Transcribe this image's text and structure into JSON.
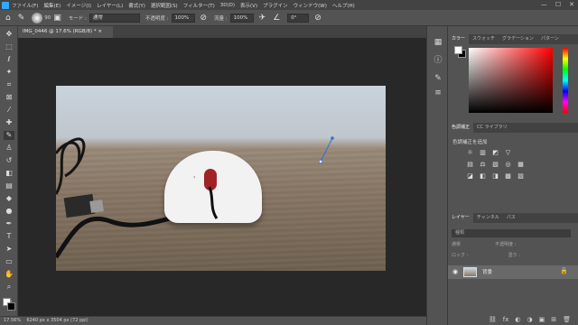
{
  "menubar": {
    "items": [
      "ファイル(F)",
      "編集(E)",
      "イメージ(I)",
      "レイヤー(L)",
      "書式(Y)",
      "選択範囲(S)",
      "フィルター(T)",
      "3D(D)",
      "表示(V)",
      "プラグイン",
      "ウィンドウ(W)",
      "ヘルプ(H)"
    ],
    "window_controls": [
      "—",
      "☐",
      "✕"
    ]
  },
  "options": {
    "brush_size": "90",
    "mode_label": "モード :",
    "mode_value": "通常",
    "opacity_label": "不透明度 :",
    "opacity_value": "100%",
    "flow_label": "流量 :",
    "flow_value": "100%",
    "angle_value": "0°"
  },
  "document": {
    "tab_title": "IMG_0446 @ 17.6% (RGB/8) *",
    "tab_close": "×"
  },
  "status": {
    "zoom": "17.56%",
    "dimensions": "6240 px x 3504 px (72 ppi)"
  },
  "panels": {
    "color_tabs": [
      "カラー",
      "スウォッチ",
      "グラデーション",
      "パターン"
    ],
    "adjust_tabs": [
      "色調補正",
      "CC ライブラリ"
    ],
    "adjust_title": "色調補正を追加",
    "adjust_icons": [
      [
        "☼",
        "▥",
        "◩",
        "▽"
      ],
      [
        "▤",
        "⚖",
        "▧",
        "◎",
        "▦"
      ],
      [
        "◪",
        "◧",
        "◨",
        "▩",
        "▨"
      ]
    ],
    "layer_tabs": [
      "レイヤー",
      "チャンネル",
      "パス"
    ],
    "layers_filter": "種類",
    "blend_mode": "通常",
    "layer_opacity": "不透明度 :",
    "lock_label": "ロック :",
    "fill_label": "塗り :",
    "layer_name": "背景",
    "footer_icons": [
      "⛓",
      "fx",
      "◐",
      "◑",
      "▣",
      "⊞",
      "🗑"
    ]
  },
  "colors": {
    "accent": "#31a8ff",
    "foreground": "#ffffff",
    "background": "#000000",
    "mouse_wheel": "#a12328"
  },
  "toolbar": {
    "icons": [
      "move-icon",
      "marquee-icon",
      "lasso-icon",
      "quick-select-icon",
      "crop-icon",
      "frame-icon",
      "eyedropper-icon",
      "healing-icon",
      "brush-icon",
      "clone-stamp-icon",
      "history-brush-icon",
      "eraser-icon",
      "gradient-icon",
      "blur-icon",
      "dodge-icon",
      "pen-icon",
      "type-icon",
      "path-select-icon",
      "rectangle-icon",
      "hand-icon",
      "zoom-icon",
      "more-icon"
    ]
  }
}
